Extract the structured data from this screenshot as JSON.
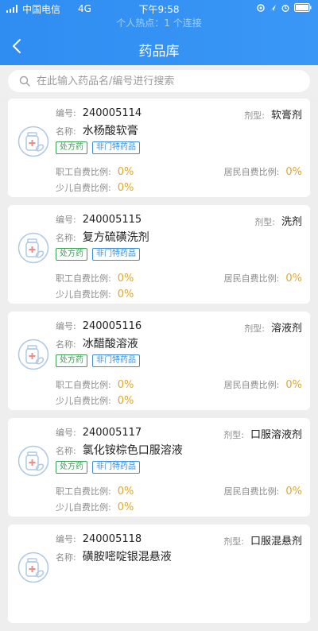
{
  "status_bar": {
    "carrier": "中国电信",
    "network": "4G",
    "time": "下午9:58",
    "hotspot": "个人热点：1 个连接"
  },
  "nav": {
    "title": "药品库"
  },
  "search": {
    "placeholder": "在此输入药品名/编号进行搜索"
  },
  "labels": {
    "id": "编号:",
    "name": "名称:",
    "type": "剂型:",
    "employee_ratio": "职工自费比例:",
    "resident_ratio": "居民自费比例:",
    "child_ratio": "少儿自费比例:"
  },
  "drugs": [
    {
      "id": "240005114",
      "name": "水杨酸软膏",
      "type": "软膏剂",
      "tags": [
        "处方药",
        "非门特药品"
      ],
      "employee": "0%",
      "resident": "0%",
      "child": "0%"
    },
    {
      "id": "240005115",
      "name": "复方硫磺洗剂",
      "type": "洗剂",
      "tags": [
        "处方药",
        "非门特药品"
      ],
      "employee": "0%",
      "resident": "0%",
      "child": "0%"
    },
    {
      "id": "240005116",
      "name": "冰醋酸溶液",
      "type": "溶液剂",
      "tags": [
        "处方药",
        "非门特药品"
      ],
      "employee": "0%",
      "resident": "0%",
      "child": "0%"
    },
    {
      "id": "240005117",
      "name": "氯化铵棕色口服溶液",
      "type": "口服溶液剂",
      "tags": [
        "处方药",
        "非门特药品"
      ],
      "employee": "0%",
      "resident": "0%",
      "child": "0%"
    },
    {
      "id": "240005118",
      "name": "磺胺嘧啶银混悬液",
      "type": "口服混悬剂",
      "tags": [],
      "employee": "",
      "resident": "",
      "child": ""
    }
  ],
  "colors": {
    "header": "#2f8df2",
    "percent": "#e1a62a",
    "tag_green": "#3aa053",
    "tag_blue": "#3b8ed6"
  },
  "icons": {
    "back": "chevron-left-icon",
    "search": "search-icon",
    "drug": "medicine-bottle-icon"
  }
}
